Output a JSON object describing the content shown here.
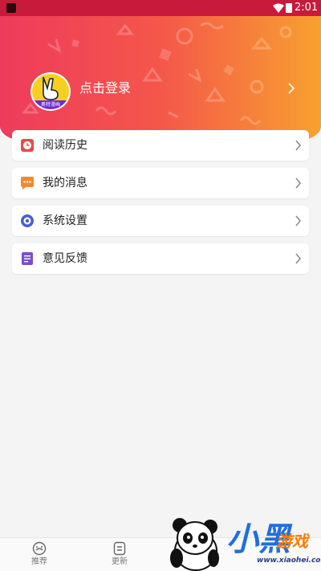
{
  "status_bar": {
    "time": "2:01"
  },
  "header": {
    "avatar_badge_text": "奥特漫画",
    "login_label": "点击登录"
  },
  "menu": [
    {
      "label": "阅读历史",
      "icon": "history-icon",
      "color": "#e84a4a"
    },
    {
      "label": "我的消息",
      "icon": "message-icon",
      "color": "#f28a2e"
    },
    {
      "label": "系统设置",
      "icon": "settings-icon",
      "color": "#4a5bd8"
    },
    {
      "label": "意见反馈",
      "icon": "feedback-icon",
      "color": "#7b4fd1"
    }
  ],
  "tab_bar": {
    "tabs": [
      {
        "label": "推荐",
        "icon": "recommend-icon"
      },
      {
        "label": "更新",
        "icon": "update-icon"
      }
    ]
  },
  "watermark": {
    "logo_text": "小黑",
    "logo_sub": "游戏",
    "url": "www.xiaohei.com"
  },
  "colors": {
    "header_start": "#ee3b5c",
    "header_end": "#f8a12f",
    "status_bar": "#c81b3c",
    "background": "#f4f4f4"
  }
}
